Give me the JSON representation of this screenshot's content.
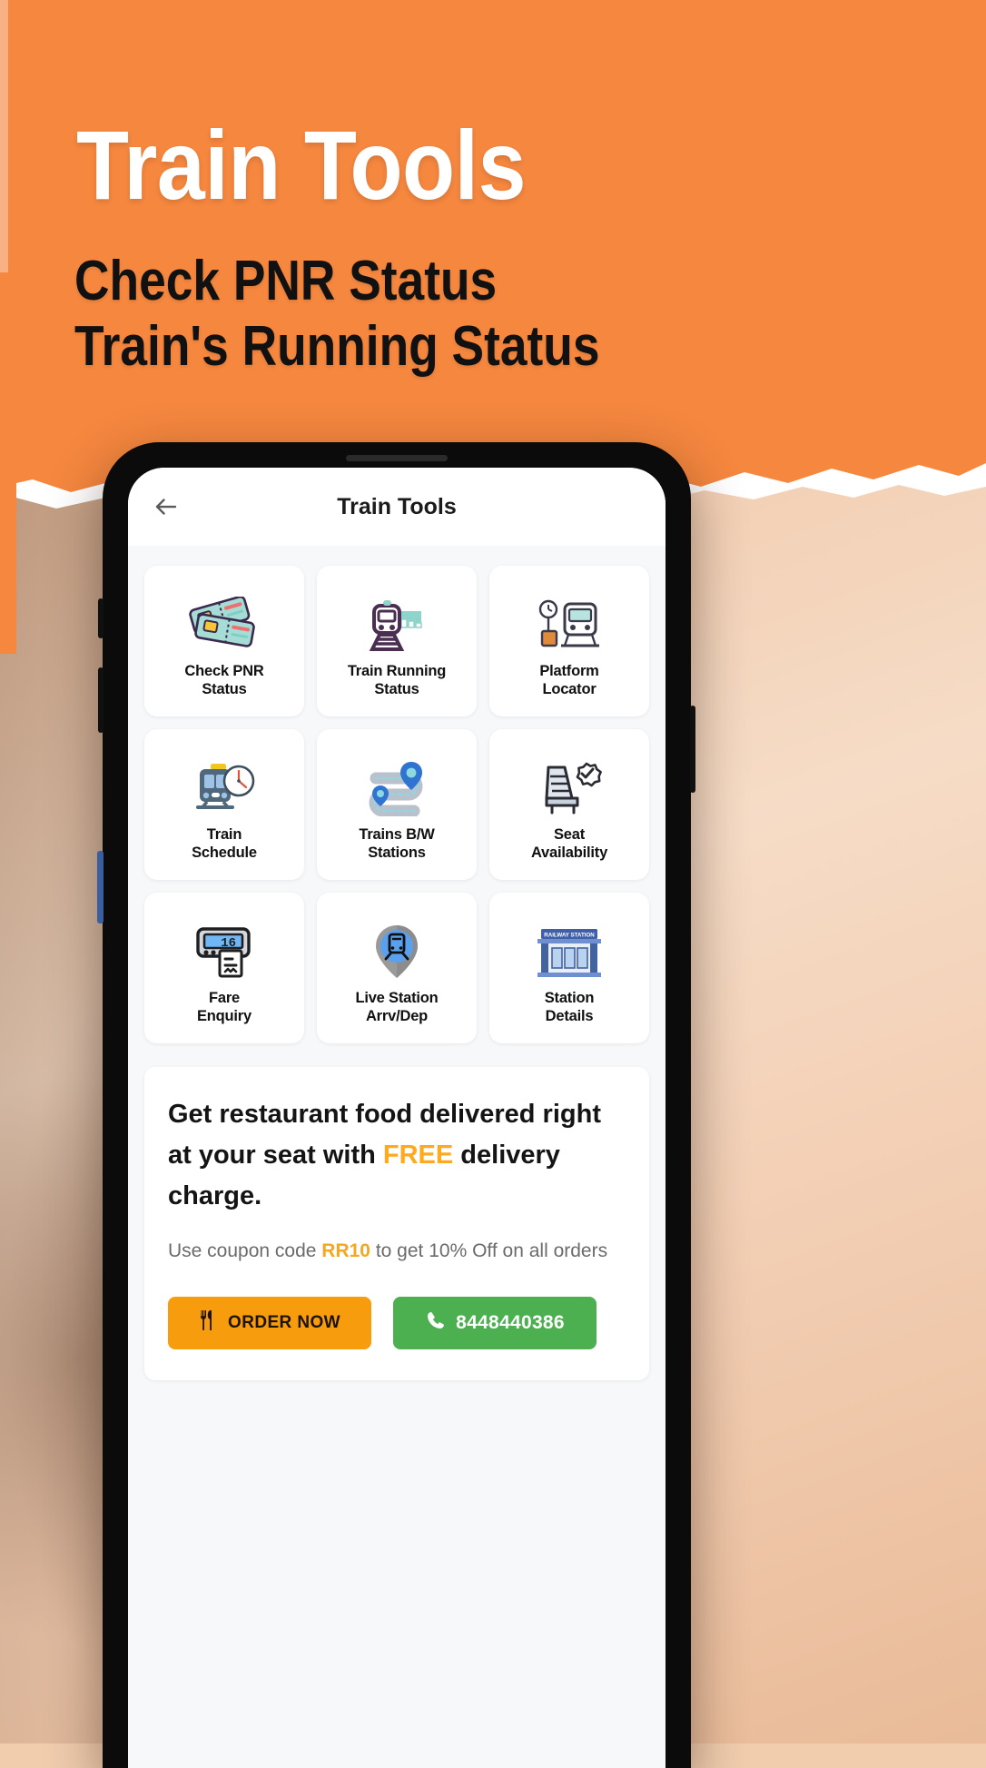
{
  "poster": {
    "title": "Train Tools",
    "subtitle_line_1": "Check PNR Status",
    "subtitle_line_2": "Train's Running Status",
    "background_color": "#f5873f",
    "title_color": "#ffffff",
    "subtitle_color": "#111111"
  },
  "app": {
    "header": {
      "back_icon": "back-arrow-icon",
      "title": "Train Tools"
    },
    "tools": [
      {
        "label_line_1": "Check PNR",
        "label_line_2": "Status",
        "icon": "tickets-icon"
      },
      {
        "label_line_1": "Train Running",
        "label_line_2": "Status",
        "icon": "train-speed-icon"
      },
      {
        "label_line_1": "Platform",
        "label_line_2": "Locator",
        "icon": "platform-clock-icon"
      },
      {
        "label_line_1": "Train",
        "label_line_2": "Schedule",
        "icon": "train-clock-icon"
      },
      {
        "label_line_1": "Trains B/W",
        "label_line_2": "Stations",
        "icon": "route-pins-icon"
      },
      {
        "label_line_1": "Seat",
        "label_line_2": "Availability",
        "icon": "seat-check-icon"
      },
      {
        "label_line_1": "Fare",
        "label_line_2": "Enquiry",
        "icon": "fare-meter-icon"
      },
      {
        "label_line_1": "Live Station",
        "label_line_2": "Arrv/Dep",
        "icon": "station-pin-icon"
      },
      {
        "label_line_1": "Station",
        "label_line_2": "Details",
        "icon": "station-building-icon"
      }
    ],
    "promo": {
      "headline_part_1": "Get restaurant food delivered right at your seat with ",
      "headline_highlight": "FREE",
      "headline_part_2": " delivery charge.",
      "highlight_color": "#FFA91F",
      "sub_part_1": "Use coupon code ",
      "sub_code": "RR10",
      "sub_part_2": " to get 10% Off on all orders",
      "code_color": "#F5A623",
      "order_button_label": "ORDER NOW",
      "order_button_icon": "fork-knife-icon",
      "order_button_color": "#F79C0C",
      "call_button_label": "8448440386",
      "call_button_icon": "phone-icon",
      "call_button_color": "#4CAF50"
    }
  }
}
